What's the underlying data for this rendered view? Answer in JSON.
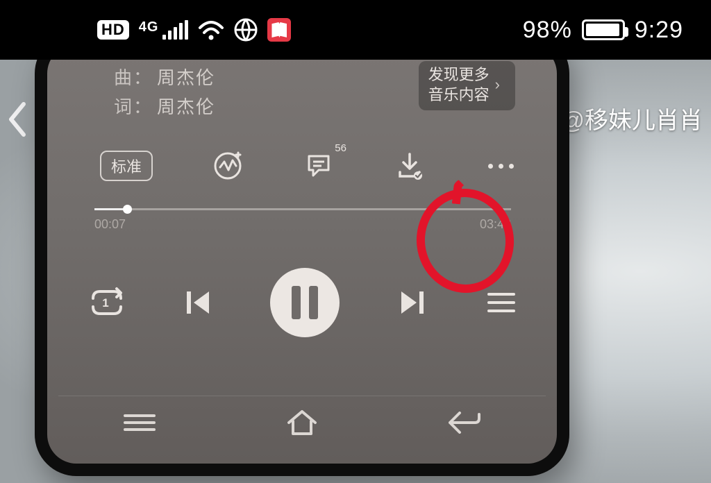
{
  "outer_status": {
    "hd": "HD",
    "net_label": "4G",
    "battery_percent": "98%",
    "time": "9:29"
  },
  "watermark": "@移妹儿肖肖",
  "player": {
    "composer_label": "曲：",
    "composer": "周杰伦",
    "lyricist_label": "词：",
    "lyricist": "周杰伦",
    "discover_line1": "发现更多",
    "discover_line2": "音乐内容",
    "quality_chip": "标准",
    "comment_count": "56",
    "elapsed": "00:07",
    "total": "03:43",
    "repeat_badge": "1"
  }
}
